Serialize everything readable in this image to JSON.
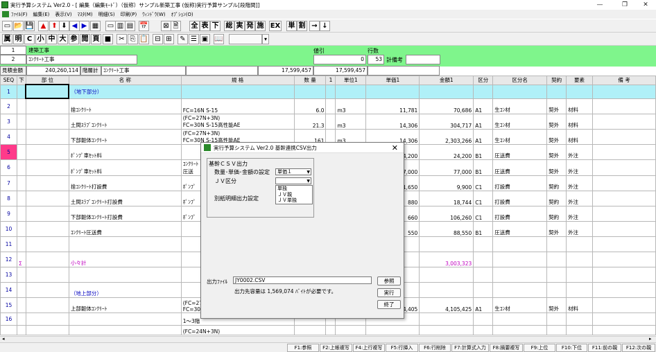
{
  "title": "実行予算システム Ver2.0 - [ 編集（編集ﾓｰﾄﾞ）（仮称）サンプル新築工事 (仮称)実行予算サンプル[段階間]]",
  "window_controls": {
    "minimize": "—",
    "restore": "❐",
    "close": "✕"
  },
  "menu": [
    "ﾌｧｲﾙ(F)",
    "編集(E)",
    "表示(V)",
    "ﾏｽﾀ(M)",
    "明細(S)",
    "印刷(P)",
    "ｳｨﾝﾄﾞｳ(W)",
    "ｵﾌﾟｼｮﾝ(O)"
  ],
  "toolbar2": [
    "属",
    "明",
    "C",
    "小",
    "中",
    "大",
    "参",
    "閲",
    "頁"
  ],
  "toolbar1_text": [
    "全",
    "表",
    "下",
    "総",
    "実",
    "発",
    "施",
    "EX",
    "単",
    "割"
  ],
  "header": {
    "row1_num": "1",
    "row1_name": "建築工事",
    "row2_num": "2",
    "row2_name": "ｺﾝｸﾘｰﾄ工事",
    "nebiki_label": "値引",
    "nebiki_value": "0",
    "gyosu_label": "行数",
    "gyosu_value": "53",
    "keibiko_label": "計備考",
    "mitsumori_label": "見積金額",
    "mitsumori_value": "240,260,114",
    "kaisokei_label": "階層計",
    "kaisokei_name": "ｺﾝｸﾘｰﾄ工事",
    "total_a": "17,599,457",
    "total_b": "17,599,457"
  },
  "columns": [
    "SEQ",
    "下",
    "部 位",
    "名 称",
    "規 格",
    "数 量",
    "1",
    "単位1",
    "単価1",
    "金額1",
    "区分",
    "区分名",
    "契約",
    "要素",
    "備 考"
  ],
  "rows": [
    {
      "seq": "1",
      "cyan": true,
      "name": "（地下部分）",
      "nameClass": "blue"
    },
    {
      "seq": "2",
      "name": "捨ｺﾝｸﾘｰﾄ",
      "spec": "FC=16N S-15",
      "qty": "6.0",
      "unit": "m3",
      "price": "11,781",
      "amount": "70,686",
      "kubun": "A1",
      "kubunmei": "生ｺﾝ材",
      "keiyaku": "契外",
      "yoso": "材料"
    },
    {
      "seq": "3",
      "name": "土間ｽﾗﾌﾞｺﾝｸﾘｰﾄ",
      "spec2": "(FC=27N+3N)",
      "spec": "FC=30N S-15高性能AE",
      "qty": "21.3",
      "unit": "m3",
      "price": "14,306",
      "amount": "304,717",
      "kubun": "A1",
      "kubunmei": "生ｺﾝ材",
      "keiyaku": "契外",
      "yoso": "材料"
    },
    {
      "seq": "4",
      "name": "下部躯体ｺﾝｸﾘｰﾄ",
      "spec2": "(FC=27N+3N)",
      "spec": "FC=30N S-15高性能AE",
      "qty": "161",
      "unit": "m3",
      "price": "14,306",
      "amount": "2,303,266",
      "kubun": "A1",
      "kubunmei": "生ｺﾝ材",
      "keiyaku": "契外",
      "yoso": "材料"
    },
    {
      "seq": "5",
      "pink": true,
      "name": "ﾎﾟﾝﾌﾟ車ｾｯﾄ料",
      "spec": "",
      "qty": "",
      "unit": "",
      "price": "24,200",
      "amount": "24,200",
      "kubun": "B1",
      "kubunmei": "圧送費",
      "keiyaku": "契外",
      "yoso": "外注"
    },
    {
      "seq": "6",
      "name": "ﾎﾟﾝﾌﾟ車ｾｯﾄ料",
      "spec2": "ｺﾝｸﾘｰﾄ",
      "spec": "圧送",
      "price": "77,000",
      "amount": "77,000",
      "kubun": "B1",
      "kubunmei": "圧送費",
      "keiyaku": "契外",
      "yoso": "外注"
    },
    {
      "seq": "7",
      "name": "捨ｺﾝｸﾘｰﾄ打設費",
      "spec": "ﾎﾟﾝﾌﾟ",
      "price": "1,650",
      "amount": "9,900",
      "kubun": "C1",
      "kubunmei": "打設費",
      "keiyaku": "契約",
      "yoso": "外注"
    },
    {
      "seq": "8",
      "name": "土間ｽﾗﾌﾞｺﾝｸﾘｰﾄ打設費",
      "spec": "ﾎﾟﾝﾌﾟ",
      "price": "880",
      "amount": "18,744",
      "kubun": "C1",
      "kubunmei": "打設費",
      "keiyaku": "契約",
      "yoso": "外注"
    },
    {
      "seq": "9",
      "name": "下部躯体ｺﾝｸﾘｰﾄ打設費",
      "spec": "ﾎﾟﾝﾌﾟ",
      "price": "660",
      "amount": "106,260",
      "kubun": "C1",
      "kubunmei": "打設費",
      "keiyaku": "契約",
      "yoso": "外注"
    },
    {
      "seq": "10",
      "name": "ｺﾝｸﾘｰﾄ圧送費",
      "spec": "",
      "price": "550",
      "amount": "88,550",
      "kubun": "B1",
      "kubunmei": "圧送費",
      "keiyaku": "契外",
      "yoso": "外注"
    },
    {
      "seq": "11",
      "name": ""
    },
    {
      "seq": "12",
      "ka": "Σ",
      "name": "小々計",
      "nameClass": "pink",
      "amount": "3,003,323",
      "amountClass": "pink"
    },
    {
      "seq": "13",
      "name": ""
    },
    {
      "seq": "14",
      "name": "（地上部分）",
      "nameClass": "blue"
    },
    {
      "seq": "15",
      "name": "上部躯体ｺﾝｸﾘｰﾄ",
      "spec2": "(FC=27",
      "spec": "FC=30N",
      "price": "14,405",
      "amount": "4,105,425",
      "kubun": "A1",
      "kubunmei": "生ｺﾝ材",
      "keiyaku": "契外",
      "yoso": "材料"
    },
    {
      "seq": "16",
      "name": "",
      "spec": "1～3階"
    },
    {
      "seq": "",
      "name": "",
      "spec": "(FC=24N+3N)"
    }
  ],
  "dialog": {
    "title": "実行予算システム Ver2.0  基幹連携CSV出力",
    "group_label": "基幹ＣＳＶ出力",
    "setting_label": "数量･単価･金額の設定",
    "setting_value": "単価１",
    "jv_label": "ＪＶ区分",
    "jv_value": "",
    "jv_options": [
      "単独",
      "ＪＶ親",
      "ＪＶ単独"
    ],
    "betsu_label": "別紙明細出力設定",
    "output_label": "出力ﾌｧｲﾙ",
    "output_value": "JY0002.CSV",
    "capacity_text": "出力先容量は 1,569,074 ﾊﾞｲﾄが必要です。",
    "browse": "参照",
    "run": "実行",
    "exit": "終了"
  },
  "function_keys": [
    "F1:参照",
    "F2:上帳複写",
    "F4:上行複写",
    "F5:行挿入",
    "F6:行削除",
    "F7:計算式入力",
    "F8:摘要複写",
    "F9:上位",
    "F10:下位",
    "F11:前の親",
    "F12:次の親"
  ]
}
